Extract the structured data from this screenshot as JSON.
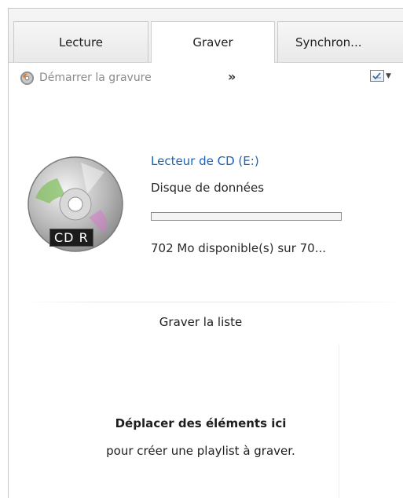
{
  "tabs": {
    "lecture": "Lecture",
    "graver": "Graver",
    "sync": "Synchron..."
  },
  "toolbar": {
    "burn_label": "Démarrer la gravure",
    "more_label": "»",
    "burn_icon": "burn-disc-icon",
    "options_icon": "list-options-icon"
  },
  "device": {
    "name": "Lecteur de CD (E:)",
    "type": "Disque de données",
    "disc_label": "CD R",
    "used_fraction": 0,
    "space_text": "702 Mo disponible(s) sur 70..."
  },
  "burn_list": {
    "title": "Graver la liste",
    "drop_title": "Déplacer des éléments ici",
    "drop_subtitle": "pour créer une playlist à graver."
  },
  "colors": {
    "link_blue": "#1d62b3",
    "tab_border": "#c9c9c9"
  }
}
